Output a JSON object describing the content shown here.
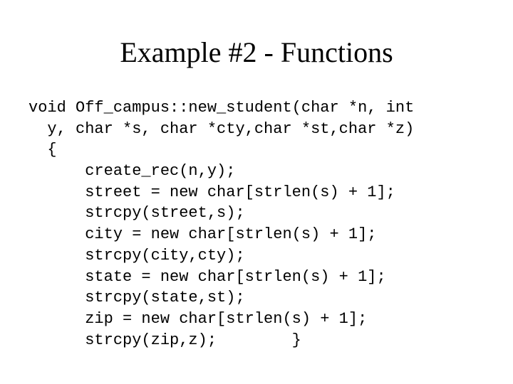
{
  "title": "Example #2 - Functions",
  "code": {
    "l1": "void Off_campus::new_student(char *n, int",
    "l2": "  y, char *s, char *cty,char *st,char *z)",
    "l3": "  {",
    "l4": "      create_rec(n,y);",
    "l5": "      street = new char[strlen(s) + 1];",
    "l6": "      strcpy(street,s);",
    "l7": "      city = new char[strlen(s) + 1];",
    "l8": "      strcpy(city,cty);",
    "l9": "      state = new char[strlen(s) + 1];",
    "l10": "      strcpy(state,st);",
    "l11": "      zip = new char[strlen(s) + 1];",
    "l12": "      strcpy(zip,z);        }"
  }
}
